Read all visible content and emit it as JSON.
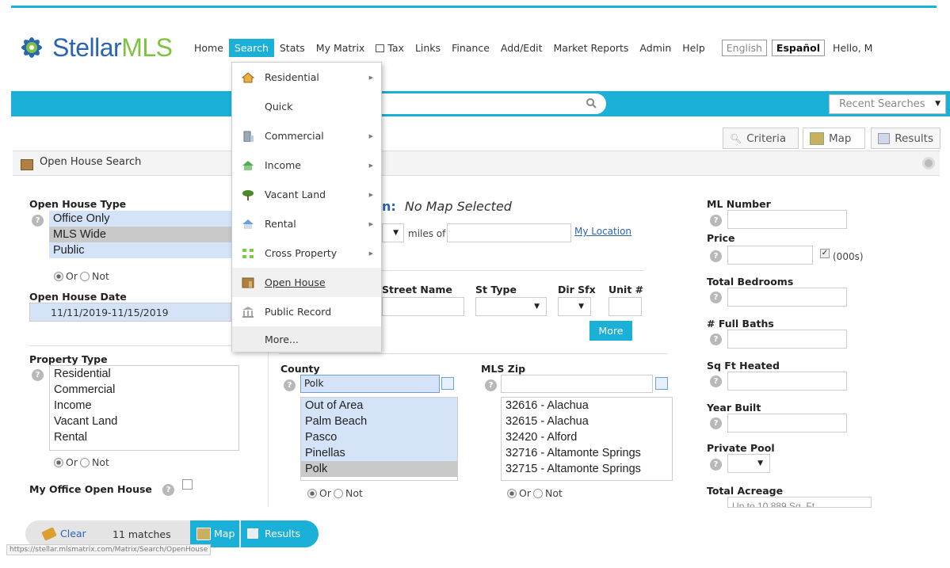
{
  "brand": {
    "logo_text_main": "Stellar",
    "logo_text_accent": "MLS"
  },
  "nav": {
    "items": [
      "Home",
      "Search",
      "Stats",
      "My Matrix",
      "Tax",
      "Links",
      "Finance",
      "Add/Edit",
      "Market Reports",
      "Admin",
      "Help"
    ],
    "active": "Search",
    "lang_english": "English",
    "lang_espanol": "Español",
    "greeting": "Hello, M"
  },
  "searchbar": {
    "recent_label": "Recent Searches"
  },
  "view_tabs": {
    "criteria": "Criteria",
    "map": "Map",
    "results": "Results"
  },
  "panel": {
    "title": "Open House Search"
  },
  "open_house_type": {
    "label": "Open House Type",
    "options": [
      "Office Only",
      "MLS Wide",
      "Public"
    ],
    "or": "Or",
    "not": "Not"
  },
  "open_house_date": {
    "label": "Open House Date",
    "value": "11/11/2019-11/15/2019"
  },
  "property_type": {
    "label": "Property Type",
    "options": [
      "Residential",
      "Commercial",
      "Income",
      "Vacant Land",
      "Rental"
    ],
    "or": "Or",
    "not": "Not"
  },
  "my_office": {
    "label": "My Office Open House"
  },
  "map_section": {
    "title_suffix": "n:",
    "title_value": "No Map Selected",
    "miles_of": "miles of",
    "my_location": "My Location"
  },
  "address": {
    "street_name": "Street Name",
    "st_type": "St Type",
    "dir_sfx": "Dir Sfx",
    "unit": "Unit #",
    "more_btn": "More"
  },
  "county": {
    "label": "County",
    "input_value": "Polk",
    "options": [
      "Out of Area",
      "Palm Beach",
      "Pasco",
      "Pinellas",
      "Polk"
    ],
    "or": "Or",
    "not": "Not"
  },
  "mls_zip": {
    "label": "MLS Zip",
    "options": [
      "32616 - Alachua",
      "32615 - Alachua",
      "32420 - Alford",
      "32716 - Altamonte Springs",
      "32715 - Altamonte Springs"
    ],
    "or": "Or",
    "not": "Not"
  },
  "right_fields": {
    "ml_number": "ML Number",
    "price": "Price",
    "price_unit": "(000s)",
    "total_bedrooms": "Total Bedrooms",
    "full_baths": "# Full Baths",
    "sq_ft_heated": "Sq Ft Heated",
    "year_built": "Year Built",
    "private_pool": "Private Pool",
    "total_acreage": "Total Acreage",
    "acreage_partial": "Up to 10,889 Sq. Ft."
  },
  "bottom": {
    "clear": "Clear",
    "matches": "11 matches",
    "map": "Map",
    "results": "Results"
  },
  "status_url": "https://stellar.mlsmatrix.com/Matrix/Search/OpenHouse",
  "search_menu": {
    "items": [
      {
        "label": "Residential",
        "icon": "house-icon",
        "submenu": true
      },
      {
        "label": "Quick",
        "icon": "",
        "submenu": false
      },
      {
        "label": "Commercial",
        "icon": "building-icon",
        "submenu": true
      },
      {
        "label": "Income",
        "icon": "money-icon",
        "submenu": true
      },
      {
        "label": "Vacant Land",
        "icon": "tree-icon",
        "submenu": true
      },
      {
        "label": "Rental",
        "icon": "rental-house-icon",
        "submenu": true
      },
      {
        "label": "Cross Property",
        "icon": "cross-arrows-icon",
        "submenu": true
      },
      {
        "label": "Open House",
        "icon": "open-house-icon",
        "submenu": false
      },
      {
        "label": "Public Record",
        "icon": "courthouse-icon",
        "submenu": false
      },
      {
        "label": "More...",
        "icon": "",
        "submenu": false
      }
    ]
  },
  "colors": {
    "accent": "#1ab0d8",
    "brand_blue": "#2a64b5",
    "brand_green": "#7fc242"
  }
}
